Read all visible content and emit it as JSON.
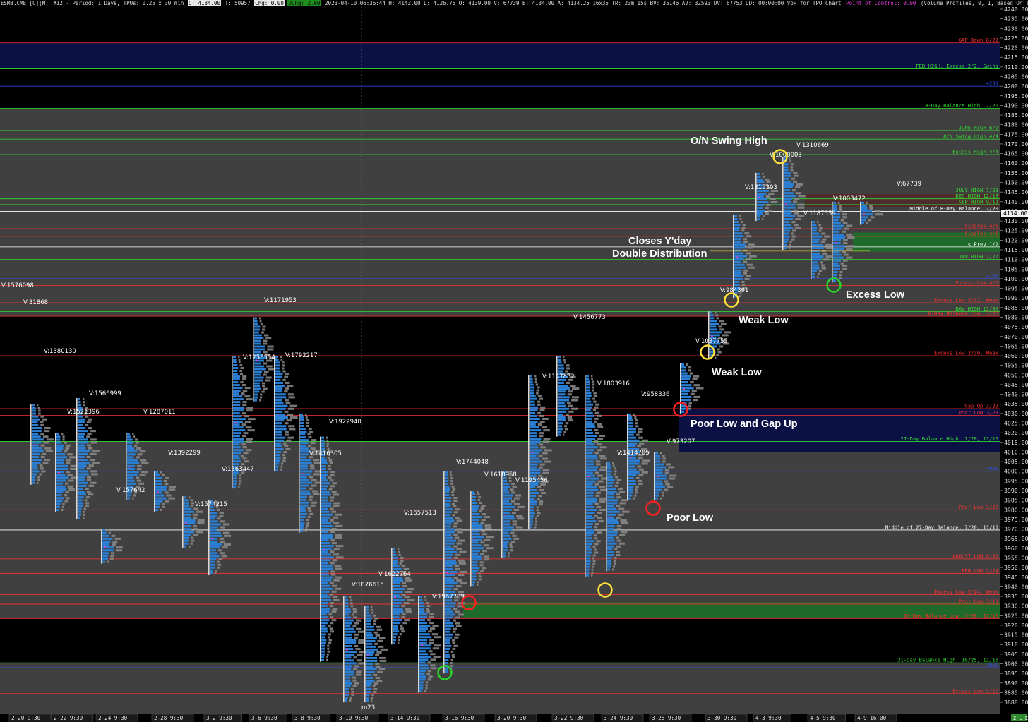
{
  "header": {
    "symbol": "ESM3.CME [C][M]",
    "chart_no": "#12 - Period: 1 Days, TPOs: 0.25 x 30 min",
    "close": "C: 4134.00",
    "ticks": "T: 50957",
    "chg": "Chg: 0.00",
    "dchg": "DChg: 2.00",
    "stats": "2023-04-10 06:36:44  H: 4143.00  L: 4126.75  O: 4139.00  V: 67739  B: 4134.00  A: 4134.25  16x35  TR: 23m 15s  BV: 35146  AV: 32593  DV: 67753  DD: 00:00:00  VbP for TPO Chart",
    "poc": "Point of Control: 0.00",
    "study": "(Volume Profiles, 0, 1, Based On TPO Chart, No, Days, 1, 50,"
  },
  "price_scale": {
    "min": 3880,
    "max": 4240,
    "step": 5,
    "last_price": "4134.00"
  },
  "time_axis": [
    "2-20  9:30",
    "2-22  9:30",
    "2-24  9:30",
    "2-28  9:30",
    "3-2  9:30",
    "3-6  9:30",
    "3-8  9:30",
    "3-10  9:30",
    "3-14  9:30",
    "3-16  9:30",
    "3-20  9:30",
    "3-22  9:30",
    "3-24  9:30",
    "3-28  9:30",
    "3-30  9:30",
    "4-3  9:30",
    "4-5  9:30",
    "4-9  16:00"
  ],
  "corner_badge": "2 L E",
  "levels": [
    {
      "price": 4222.5,
      "label": "GAP Down 8/22",
      "color": "#ff3030"
    },
    {
      "price": 4209.0,
      "label": "FEB HIGH, Excess 2/2, Swing",
      "color": "#33dd33"
    },
    {
      "price": 4200.0,
      "label": "4200",
      "color": "#3050ff"
    },
    {
      "price": 4188.5,
      "label": "8-Day Balance High, 7/20",
      "color": "#33dd33"
    },
    {
      "price": 4177.0,
      "label": "JUNE HIGH 6/2",
      "color": "#33dd33"
    },
    {
      "price": 4172.5,
      "label": "O/N Swing High 4/4",
      "color": "#33dd33"
    },
    {
      "price": 4164.5,
      "label": "Excess High 4/4",
      "color": "#33dd33"
    },
    {
      "price": 4144.5,
      "label": "JULY HIGH 7/29",
      "color": "#33dd33"
    },
    {
      "price": 4141.5,
      "label": "DEC HIGH 12/13",
      "color": "#33dd33"
    },
    {
      "price": 4138.5,
      "label": "SEP HIGH 9/12",
      "color": "#33dd33"
    },
    {
      "price": 4135.0,
      "label": "Middle of 8-Day Balance, 7/20",
      "color": "#ffffff"
    },
    {
      "price": 4126.0,
      "label": "Singles 4/6",
      "color": "#ff3030"
    },
    {
      "price": 4122.0,
      "label": "Singles 4/6",
      "color": "#ff3030"
    },
    {
      "price": 4116.5,
      "label": "< Prev 1/2",
      "color": "#ffffff"
    },
    {
      "price": 4110.0,
      "label": "JAN HIGH 1/27",
      "color": "#33dd33"
    },
    {
      "price": 4100.0,
      "label": "4100",
      "color": "#3050ff"
    },
    {
      "price": 4096.5,
      "label": "Excess Low 4/6",
      "color": "#ff3030"
    },
    {
      "price": 4087.5,
      "label": "Excess Low 3/31, Weak",
      "color": "#ff3030"
    },
    {
      "price": 4083.0,
      "label": "NOV HIGH 11/30",
      "color": "#33dd33"
    },
    {
      "price": 4080.5,
      "label": "8-Day Balance Low, 7/20",
      "color": "#ff3030"
    },
    {
      "price": 4060.0,
      "label": "Excess Low 3/30, Weak",
      "color": "#ff3030"
    },
    {
      "price": 4032.5,
      "label": "Gap Up 3/29",
      "color": "#ff3030"
    },
    {
      "price": 4029.0,
      "label": "Poor Low 3/28",
      "color": "#ff3030"
    },
    {
      "price": 4015.5,
      "label": "27-Day Balance High, 7/20, 11/10",
      "color": "#33dd33"
    },
    {
      "price": 4000.0,
      "label": "4000",
      "color": "#3050ff"
    },
    {
      "price": 3980.0,
      "label": "Poor Low 3/28",
      "color": "#ff3030"
    },
    {
      "price": 3969.5,
      "label": "Middle of 27-Day Balance, 7/20, 11/10",
      "color": "#ffffff"
    },
    {
      "price": 3954.5,
      "label": "AUGUST LOW 8/31",
      "color": "#ff3030"
    },
    {
      "price": 3947.0,
      "label": "FEB LOW 2/24",
      "color": "#ff3030"
    },
    {
      "price": 3936.0,
      "label": "Excess Low 3/24, Weak",
      "color": "#ff3030"
    },
    {
      "price": 3931.0,
      "label": "Poor Low 3/13",
      "color": "#ff3030"
    },
    {
      "price": 3923.5,
      "label": "27-Day Balance Low, 7/20, 11/10",
      "color": "#ff3030"
    },
    {
      "price": 3900.5,
      "label": "21-Day Balance High, 10/25, 12/16",
      "color": "#33dd33"
    },
    {
      "price": 3898.0,
      "label": "3900",
      "color": "#3050ff"
    },
    {
      "price": 3884.5,
      "label": "Excess Low 3/10",
      "color": "#ff3030"
    }
  ],
  "volume_labels": [
    "V:1576098",
    "V:31868",
    "V:1380130",
    "V:1566999",
    "V:1521396",
    "V:1287011",
    "V:1392299",
    "V:157642",
    "V:1574215",
    "V:1171953",
    "V:1256554",
    "V:1792217",
    "V:1363447",
    "V:1416305",
    "V:1922940",
    "V:1876615",
    "V:1622764",
    "V:1657513",
    "V:1967709",
    "V:1744048",
    "V:1618958",
    "V:1195456",
    "V:1147852",
    "V:1456773",
    "V:1803916",
    "V:958336",
    "V:1414705",
    "V:973207",
    "V:1037755",
    "V:984391",
    "V:1215303",
    "V:1310669",
    "V:1000003",
    "V:1003472",
    "V:1187559",
    "V:67739",
    "m23"
  ],
  "annotations": {
    "on_swing_high": "O/N Swing High",
    "closes_yday": "Closes Y'day",
    "double_distribution": "Double Distribution",
    "excess_low": "Excess Low",
    "weak_low_1": "Weak Low",
    "weak_low_2": "Weak Low",
    "poor_low_gap_up": "Poor Low and Gap Up",
    "poor_low": "Poor Low"
  },
  "colors": {
    "background": "#000000",
    "balance_zone": "#404040",
    "gap_zone": "#0b1045",
    "tpo_blue": "#2a7fd4",
    "profile_gray": "#8c8c8c",
    "green_zone": "#1f6a2a",
    "yellow_circle": "#ffe23a",
    "red_circle": "#ff2020",
    "green_circle": "#28d428"
  }
}
